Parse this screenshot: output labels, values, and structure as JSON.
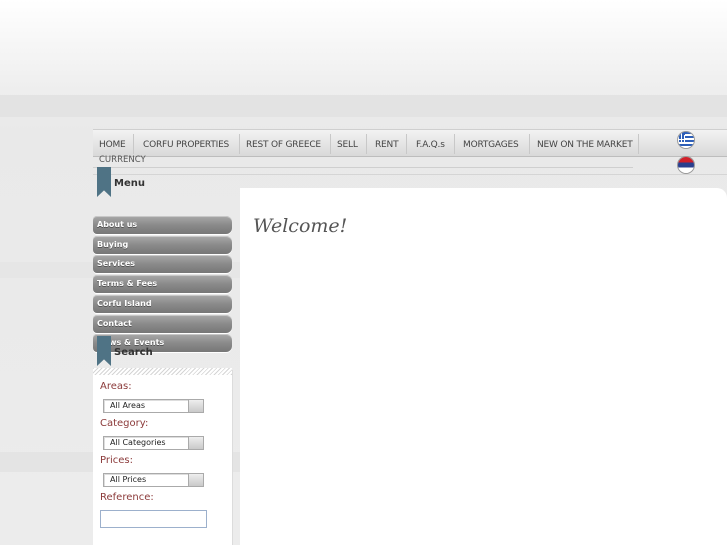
{
  "nav": {
    "items": [
      "HOME",
      "CORFU PROPERTIES",
      "REST OF GREECE",
      "SELL",
      "RENT",
      "F.A.Q.s",
      "MORTGAGES",
      "NEW ON THE MARKET"
    ]
  },
  "currency_label": "CURRENCY",
  "menu": {
    "title": "Menu",
    "items": [
      "About us",
      "Buying",
      "Services",
      "Terms & Fees",
      "Corfu Island",
      "Contact",
      "News & Events"
    ]
  },
  "search": {
    "title": "Search",
    "areas_label": "Areas:",
    "areas_value": "All Areas",
    "category_label": "Category:",
    "category_value": "All Categories",
    "prices_label": "Prices:",
    "prices_value": "All Prices",
    "reference_label": "Reference:",
    "reference_value": ""
  },
  "main": {
    "welcome": "Welcome!"
  },
  "icons": {
    "language_1": "greek-flag-icon",
    "language_2": "serbian-flag-icon",
    "bookmark": "bookmark-ribbon-icon"
  },
  "colors": {
    "ribbon": "#4f7385",
    "field_label": "#8b3a3a",
    "menu_button": "#8a8a8a"
  }
}
